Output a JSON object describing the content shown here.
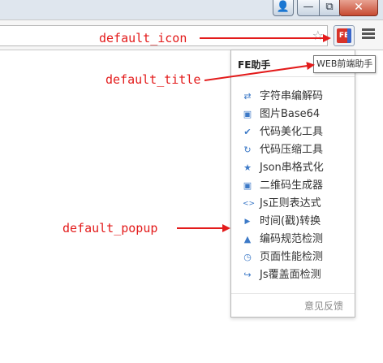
{
  "window": {
    "user_glyph": "👤",
    "minimize_glyph": "—",
    "maximize_glyph": "⧉",
    "close_glyph": "✕"
  },
  "toolbar": {
    "star_glyph": "☆",
    "extension_logo_text": "FE"
  },
  "tooltip": {
    "text": "WEB前端助手"
  },
  "popup": {
    "title": "FE助手",
    "items": [
      {
        "label": "字符串编解码",
        "icon": "swap-arrows-icon",
        "glyph": "⇄"
      },
      {
        "label": "图片Base64",
        "icon": "image-icon",
        "glyph": "▣"
      },
      {
        "label": "代码美化工具",
        "icon": "check-icon",
        "glyph": "✔"
      },
      {
        "label": "代码压缩工具",
        "icon": "refresh-icon",
        "glyph": "↻"
      },
      {
        "label": "Json串格式化",
        "icon": "star-icon",
        "glyph": "★"
      },
      {
        "label": "二维码生成器",
        "icon": "qrcode-icon",
        "glyph": "▣"
      },
      {
        "label": "Js正则表达式",
        "icon": "code-icon",
        "glyph": "<>"
      },
      {
        "label": "时间(戳)转换",
        "icon": "play-icon",
        "glyph": "▶"
      },
      {
        "label": "编码规范检测",
        "icon": "warning-icon",
        "glyph": "▲"
      },
      {
        "label": "页面性能检测",
        "icon": "clock-icon",
        "glyph": "◷"
      },
      {
        "label": "Js覆盖面检测",
        "icon": "share-arrow-icon",
        "glyph": "↪"
      }
    ],
    "footer_link": "意见反馈"
  },
  "annotations": {
    "icon_label": "default_icon",
    "title_label": "default_title",
    "popup_label": "default_popup",
    "color": "#e31b1b"
  },
  "colors": {
    "accent_blue": "#3c79c7",
    "annotation_red": "#e31b1b",
    "close_red": "#c74a31"
  }
}
